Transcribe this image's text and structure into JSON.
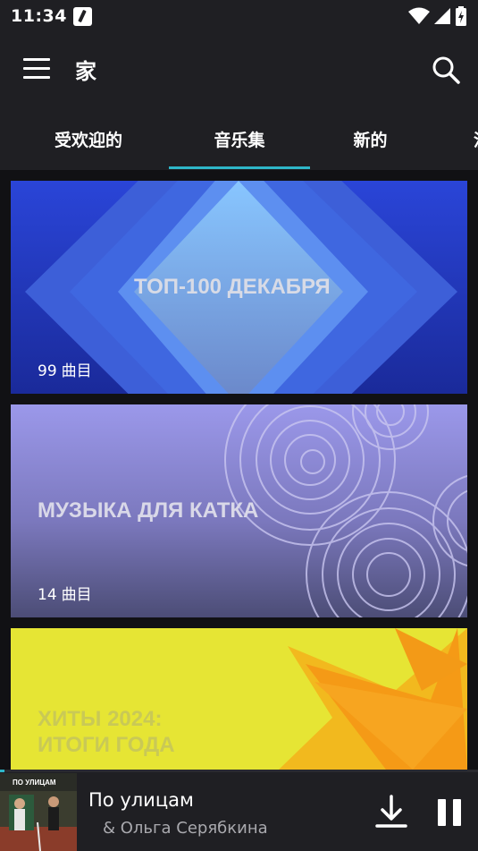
{
  "status_bar": {
    "time": "11:34",
    "icons": [
      "edit-icon",
      "wifi-icon",
      "signal-icon",
      "battery-icon"
    ]
  },
  "app_bar": {
    "title": "家",
    "menu_icon": "hamburger-menu-icon",
    "search_icon": "search-icon"
  },
  "tabs": {
    "items": [
      {
        "label": "受欢迎的"
      },
      {
        "label": "音乐集"
      },
      {
        "label": "新的"
      },
      {
        "label": "流"
      }
    ],
    "selected": "音乐集",
    "accent_color": "#2eb6c8"
  },
  "collections": [
    {
      "title": "ТОП-100 ДЕКАБРЯ",
      "count": "99",
      "count_label": "曲目",
      "colors": [
        "#1d2fae",
        "#5f8be6"
      ]
    },
    {
      "title": "МУЗЫКА ДЛЯ КАТКА",
      "count": "14",
      "count_label": "曲目",
      "colors": [
        "#8f8ce0",
        "#5e5f8b"
      ]
    },
    {
      "title_line1": "ХИТЫ 2024:",
      "title_line2": "ИТОГИ ГОДА",
      "colors": [
        "#e8e73a",
        "#f59a16"
      ]
    }
  ],
  "player": {
    "cover_text": "ПО УЛИЦАМ",
    "track_title": "По улицам",
    "artist": "&  Ольга Серябкина",
    "progress": 0.01,
    "download_icon": "download-icon",
    "pause_icon": "pause-icon"
  }
}
